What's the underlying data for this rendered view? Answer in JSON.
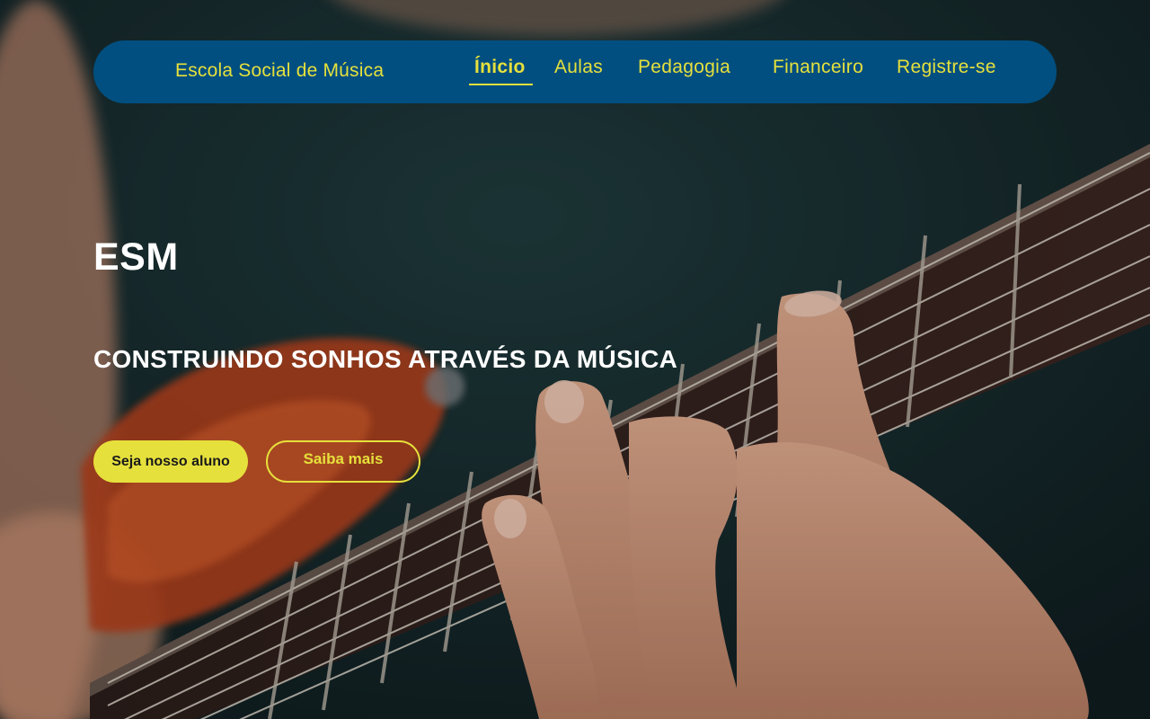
{
  "navbar": {
    "brand": "Escola Social de Música",
    "items": [
      {
        "label": "Ínicio",
        "active": true
      },
      {
        "label": "Aulas",
        "active": false
      },
      {
        "label": "Pedagogia",
        "active": false
      },
      {
        "label": "Financeiro",
        "active": false
      },
      {
        "label": "Registre-se",
        "active": false
      }
    ]
  },
  "hero": {
    "title": "ESM",
    "subtitle": "CONSTRUINDO SONHOS ATRAVÉS DA MÚSICA",
    "background": "guitar-photo",
    "primary_button": "Seja nosso aluno",
    "secondary_button": "Saiba mais"
  },
  "colors": {
    "accent": "#e6e03c",
    "navbar": "#004f80",
    "hero_text": "#ffffff"
  }
}
